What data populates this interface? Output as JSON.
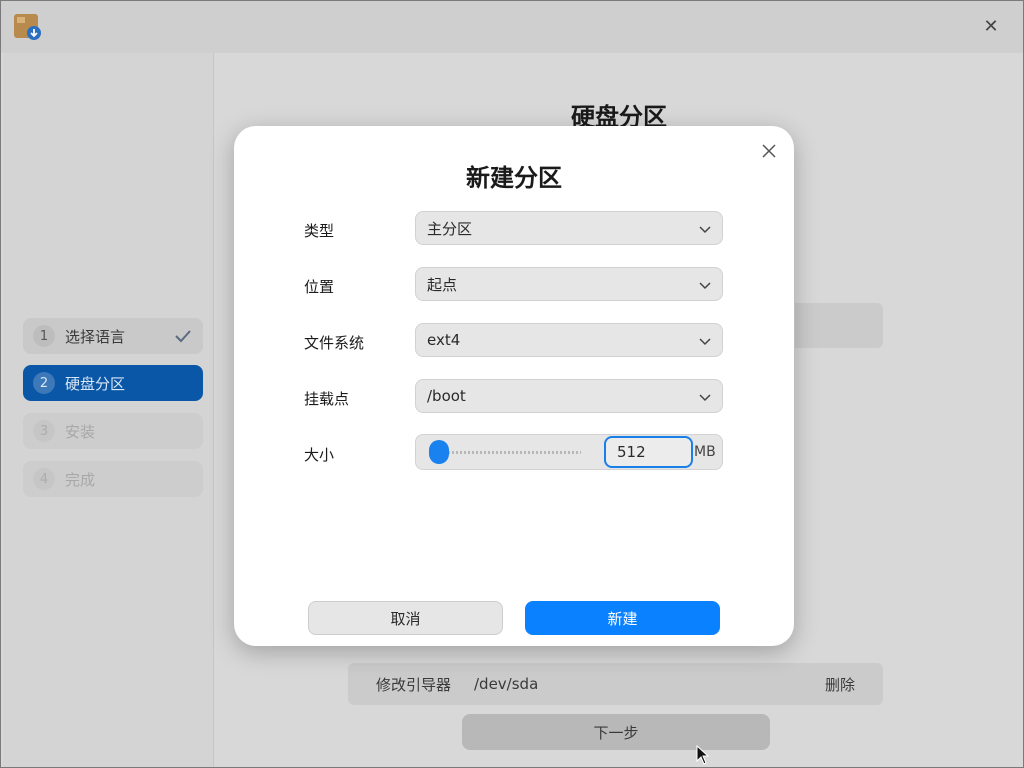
{
  "window": {
    "close_symbol": "✕"
  },
  "sidebar": {
    "steps": [
      {
        "number": "1",
        "label": "选择语言",
        "state": "done"
      },
      {
        "number": "2",
        "label": "硬盘分区",
        "state": "active"
      },
      {
        "number": "3",
        "label": "安装",
        "state": "disabled"
      },
      {
        "number": "4",
        "label": "完成",
        "state": "disabled"
      }
    ]
  },
  "main": {
    "title": "硬盘分区",
    "bootloader": {
      "label": "修改引导器",
      "device": "/dev/sda",
      "delete_label": "删除"
    },
    "next_label": "下一步"
  },
  "dialog": {
    "title": "新建分区",
    "fields": {
      "type": {
        "label": "类型",
        "value": "主分区"
      },
      "location": {
        "label": "位置",
        "value": "起点"
      },
      "filesystem": {
        "label": "文件系统",
        "value": "ext4"
      },
      "mountpoint": {
        "label": "挂载点",
        "value": "/boot"
      },
      "size": {
        "label": "大小",
        "value": "512",
        "unit": "MB"
      }
    },
    "cancel_label": "取消",
    "create_label": "新建"
  },
  "colors": {
    "accent": "#0a81ff",
    "sidebar_active": "#0a57a8"
  }
}
